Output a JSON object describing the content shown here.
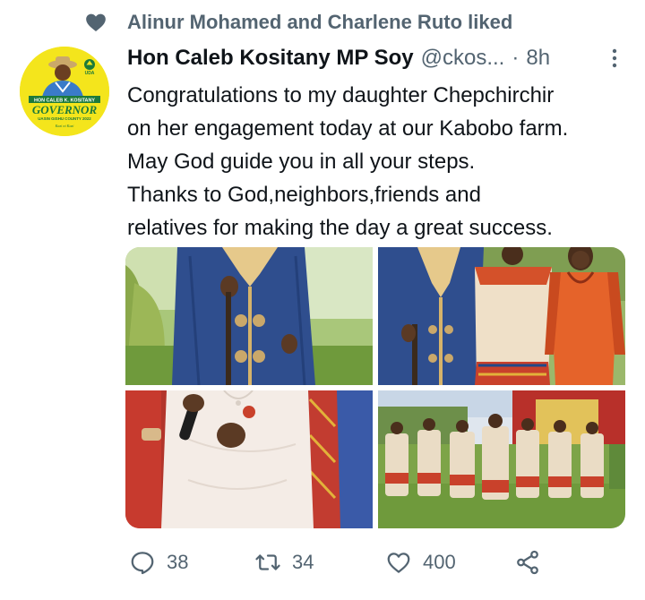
{
  "social_context": {
    "text": "Alinur Mohamed and Charlene Ruto liked",
    "icon": "heart-icon"
  },
  "tweet": {
    "author_name": "Hon Caleb Kositany MP Soy",
    "handle": "@ckos...",
    "separator": "·",
    "time": "8h",
    "avatar": {
      "line1": "HON CALEB K. KOSITANY",
      "line2": "GOVERNOR",
      "line3": "UASIN GISHU COUNTY 2022",
      "party": "UDA",
      "slogan": "Kazi ni Kazi"
    },
    "text_lines": [
      "Congratulations to my daughter Chepchirchir",
      "on her engagement today at our Kabobo farm.",
      "May God guide you in all your steps.",
      "Thanks to God,neighbors,friends and",
      "relatives for making the day a great success."
    ]
  },
  "media": {
    "photos": [
      {
        "name": "photo-1",
        "subject": "man in blue embroidered robe with walking stick"
      },
      {
        "name": "photo-2",
        "subject": "man in blue robe beside women in orange dresses"
      },
      {
        "name": "photo-3",
        "subject": "woman in white lace dress holding microphone"
      },
      {
        "name": "photo-4",
        "subject": "group of women in matching dresses on lawn"
      }
    ]
  },
  "actions": {
    "replies": "38",
    "retweets": "34",
    "likes": "400"
  },
  "colors": {
    "text": "#0f1419",
    "secondary": "#536471",
    "avatar_bg": "#f4e51c",
    "robe_blue": "#2f4e8e",
    "grass": "#6f9a3c"
  }
}
